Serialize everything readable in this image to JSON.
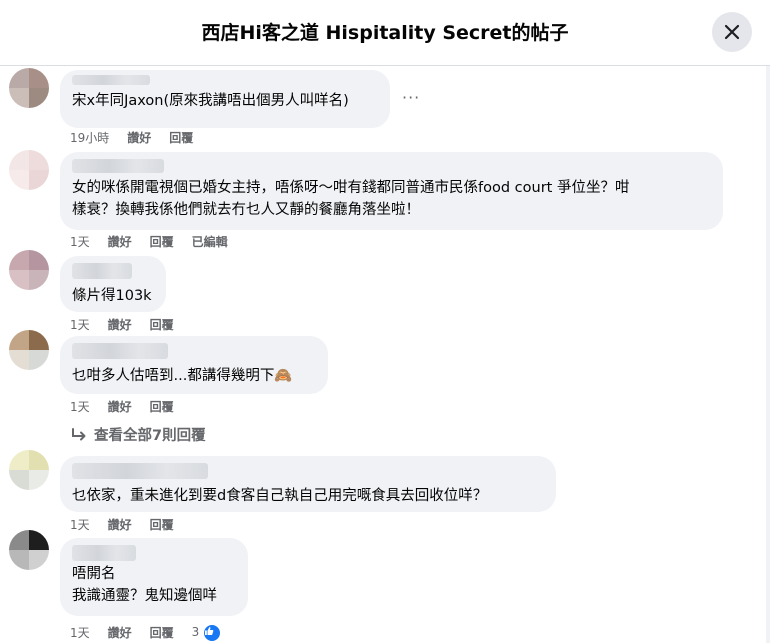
{
  "header": {
    "title": "西店Hi客之道 Hispitality Secret的帖子",
    "close_icon": "close-icon"
  },
  "comments": [
    {
      "text": "宋x年同Jaxon(原來我講唔出個男人叫咩名)",
      "meta": [
        "19小時",
        "讚好",
        "回覆"
      ],
      "avatar_colors": [
        "#b9aaa8",
        "#a89088",
        "#cbbdb8",
        "#9d8a80"
      ]
    },
    {
      "text": "女的咪係開電視個已婚女主持，唔係呀～咁有錢都同普通市民係food court 爭位坐？咁\n樣衰？換轉我係他們就去冇乜人又靜的餐廳角落坐啦！",
      "meta": [
        "1天",
        "讚好",
        "回覆",
        "已編輯"
      ],
      "avatar_colors": [
        "#f3e6e6",
        "#eedcdc",
        "#f6eaea",
        "#ead6d6"
      ]
    },
    {
      "text": "條片得103k",
      "meta": [
        "1天",
        "讚好",
        "回覆"
      ],
      "avatar_colors": [
        "#c7a8ae",
        "#b495a0",
        "#d8c0c4",
        "#c9b4ba"
      ]
    },
    {
      "text": "乜咁多人估唔到...都講得幾明下🙈",
      "meta": [
        "1天",
        "讚好",
        "回覆"
      ],
      "avatar_colors": [
        "#c2a587",
        "#8c6a4c",
        "#e4ddd3",
        "#d6d9d5"
      ]
    },
    {
      "text": "乜依家，重未進化到要d食客自己執自己用完嘅食具去回收位咩？",
      "meta": [
        "1天",
        "讚好",
        "回覆"
      ],
      "avatar_colors": [
        "#eeedc8",
        "#e2e0b0",
        "#d9dcd4",
        "#e9ebe6"
      ]
    },
    {
      "text": "唔開名\n我識通靈？鬼知邊個咩",
      "meta": [
        "1天",
        "讚好",
        "回覆"
      ],
      "reaction_count": "3",
      "avatar_colors": [
        "#8a8a8a",
        "#1e1e1e",
        "#b8b8b8",
        "#d0d0d0"
      ]
    }
  ],
  "view_replies": "查看全部7則回覆",
  "more_icon": "more-options-icon"
}
